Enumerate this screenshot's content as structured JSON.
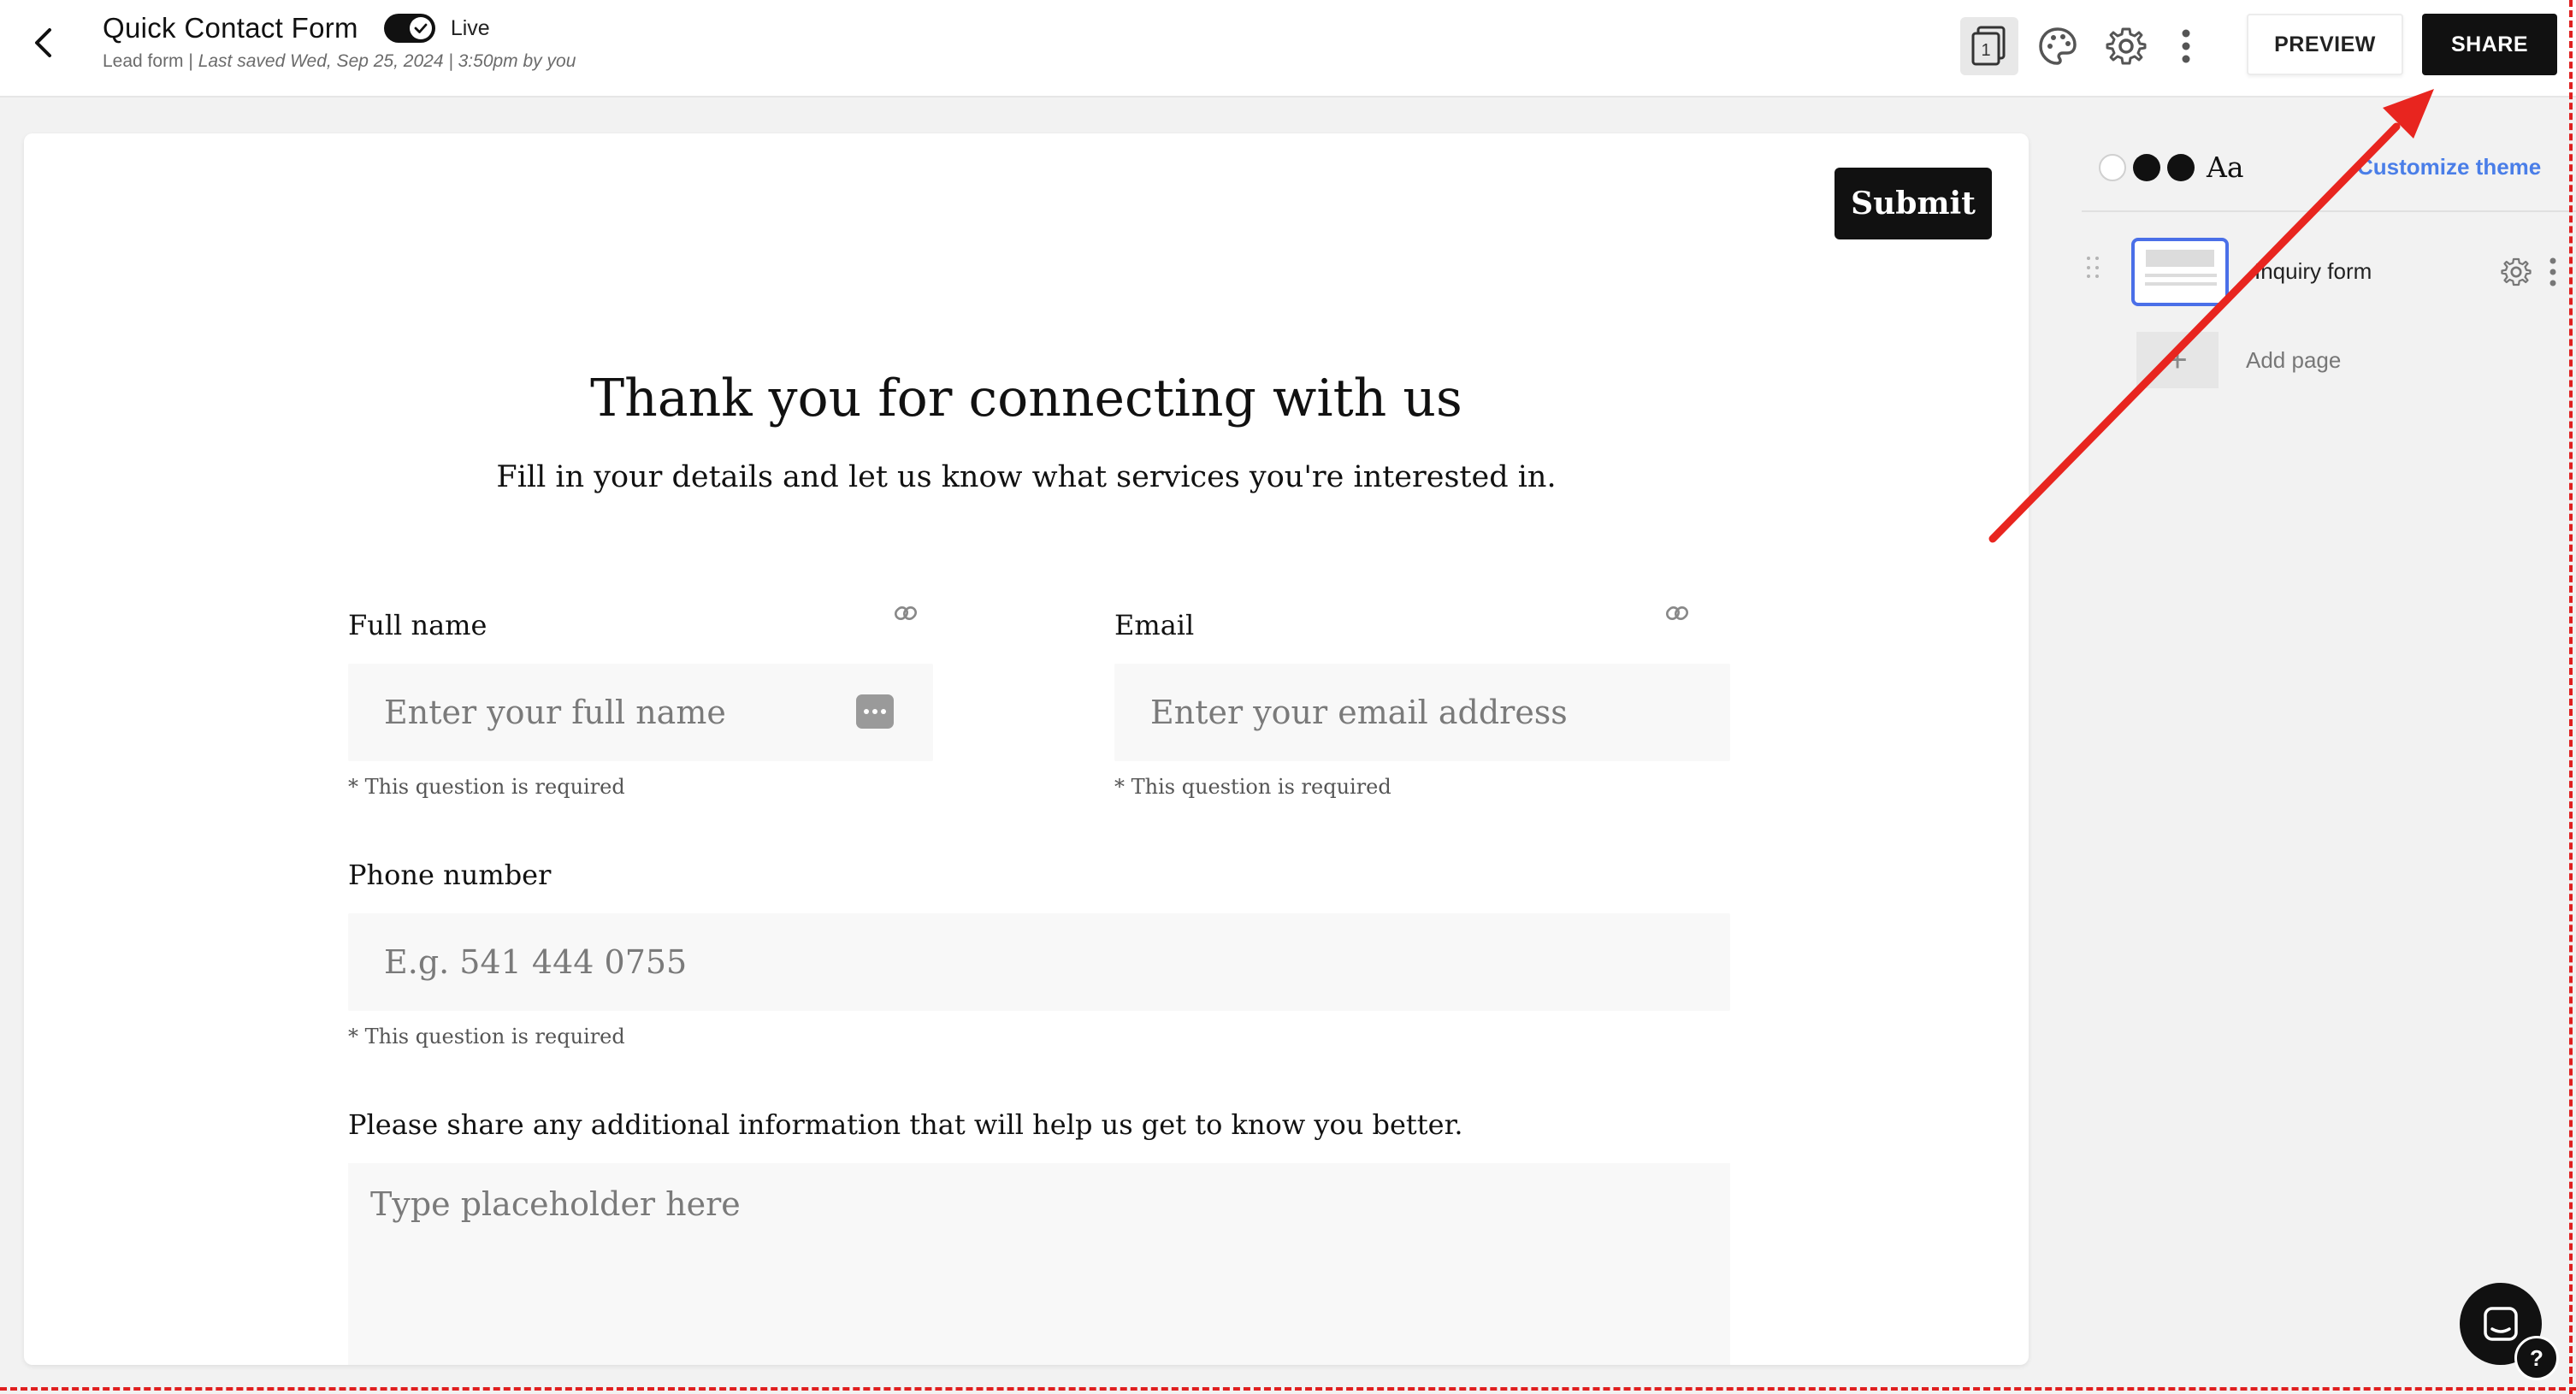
{
  "header": {
    "title": "Quick Contact Form",
    "live_label": "Live",
    "subtitle_prefix": "Lead form | ",
    "subtitle_saved": "Last saved Wed, Sep 25, 2024 | 3:50pm by you",
    "pages_count": "1",
    "preview_label": "PREVIEW",
    "share_label": "SHARE",
    "icons": [
      "pages-icon",
      "palette-icon",
      "gear-icon",
      "more-vertical-icon",
      "chevron-left-icon"
    ]
  },
  "form": {
    "submit_label": "Submit",
    "heading": "Thank you for connecting with us",
    "subheading": "Fill in your details and let us know what services you're interested in.",
    "fields": {
      "full_name": {
        "label": "Full name",
        "placeholder": "Enter your full name",
        "required_note": "* This question is required"
      },
      "email": {
        "label": "Email",
        "placeholder": "Enter your email address",
        "required_note": "* This question is required"
      },
      "phone": {
        "label": "Phone number",
        "placeholder": "E.g. 541 444 0755",
        "required_note": "* This question is required"
      },
      "additional": {
        "label": "Please share any additional information that will help us get to know you better.",
        "placeholder": "Type placeholder here"
      }
    }
  },
  "sidebar": {
    "theme_sample": "Aa",
    "customize_label": "Customize theme",
    "pages": [
      {
        "name": "Inquiry form"
      }
    ],
    "add_page_label": "Add page",
    "add_page_symbol": "+"
  },
  "help": {
    "help_symbol": "?"
  },
  "colors": {
    "accent": "#111111",
    "link": "#4a7ee8",
    "selected_border": "#4a6fe8",
    "annotation": "#e02020"
  }
}
